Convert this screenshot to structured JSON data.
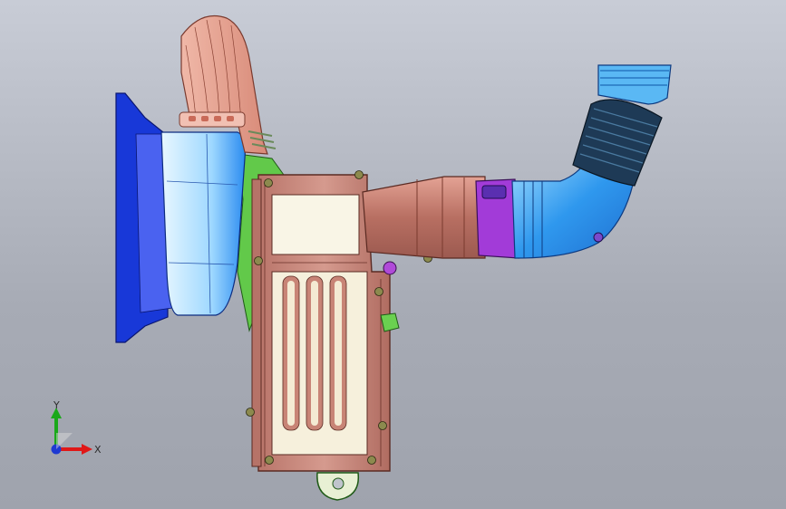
{
  "window": {
    "type": "cad-3d-viewport"
  },
  "triad": {
    "x_label": "X",
    "y_label": "Y",
    "x_color": "#e01818",
    "y_color": "#1aa81a",
    "z_color": "#1e3ad2"
  },
  "model": {
    "parts": [
      "scoop-housing",
      "inlet-duct",
      "hose-clamp",
      "green-bracket",
      "filter-box",
      "filter-lid",
      "element-ribs",
      "outlet-tube",
      "purple-coupling",
      "blue-elbow",
      "corrugated-hose",
      "hose-cuff",
      "bottom-bracket"
    ],
    "colors": {
      "scoop_dark": "#1838d8",
      "scoop_light": "#bde8ff",
      "inlet_duct": "#e8a090",
      "filter_box": "#c77e72",
      "bracket": "#5ec447",
      "coupling": "#a23bd8",
      "elbow": "#3aa0f0",
      "hose": "#1e3a56"
    }
  }
}
